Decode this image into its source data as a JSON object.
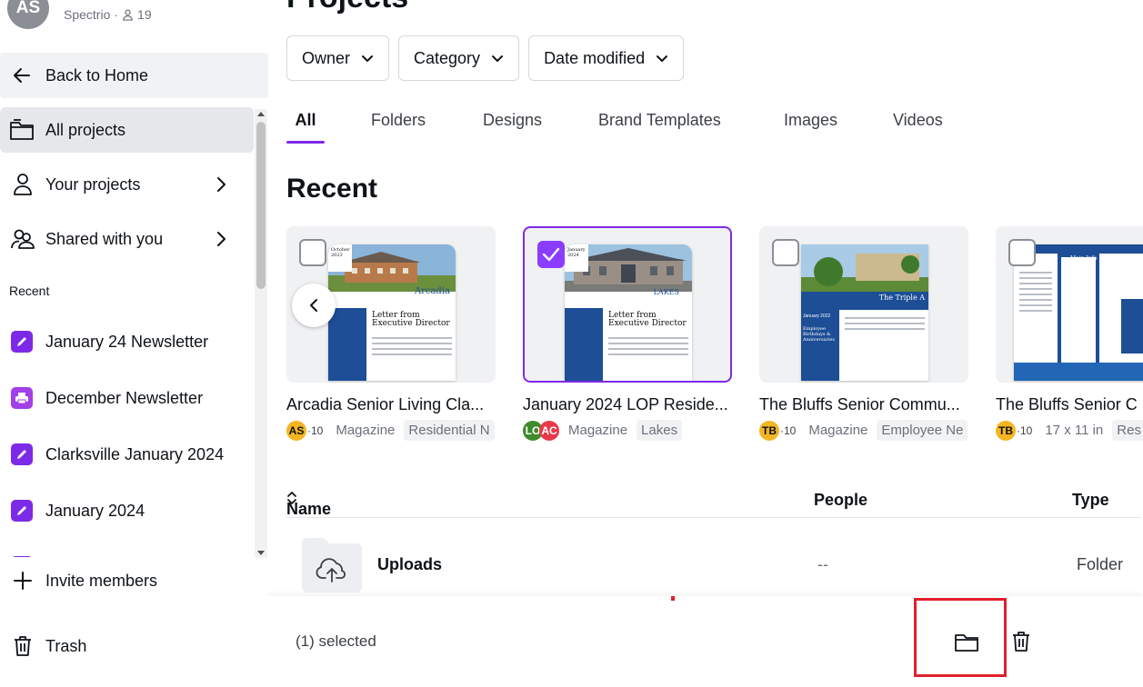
{
  "team": {
    "initials": "AS",
    "name": "Spectrio",
    "members": "19"
  },
  "sidebar": {
    "back_home": "Back to Home",
    "nav": [
      {
        "label": "All projects"
      },
      {
        "label": "Your projects"
      },
      {
        "label": "Shared with you"
      }
    ],
    "recent_heading": "Recent",
    "recent": [
      {
        "label": "January 24 Newsletter"
      },
      {
        "label": "December Newsletter"
      },
      {
        "label": "Clarksville January 2024"
      },
      {
        "label": "January 2024"
      }
    ],
    "invite": "Invite members",
    "trash": "Trash"
  },
  "main": {
    "title": "Projects",
    "filters": [
      {
        "label": "Owner"
      },
      {
        "label": "Category"
      },
      {
        "label": "Date modified"
      }
    ],
    "tabs": [
      {
        "label": "All",
        "active": true
      },
      {
        "label": "Folders"
      },
      {
        "label": "Designs"
      },
      {
        "label": "Brand Templates"
      },
      {
        "label": "Images"
      },
      {
        "label": "Videos"
      }
    ],
    "recent_title": "Recent",
    "cards": [
      {
        "title": "Arcadia Senior Living Cla...",
        "owner": "AS",
        "extra": "·10",
        "type": "Magazine",
        "tag": "Residential N",
        "date": "October 2023",
        "heading": "Letter from Executive Director",
        "brand": "Arcadia",
        "selected": false
      },
      {
        "title": "January 2024 LOP Reside...",
        "owner": "LO",
        "owner2": "AC",
        "type": "Magazine",
        "tag": "Lakes",
        "date": "January 2024",
        "heading": "Letter from Executive Director",
        "brand": "LAKES",
        "selected": true
      },
      {
        "title": "The Bluffs Senior Commu...",
        "owner": "TB",
        "extra": "·10",
        "type": "Magazine",
        "tag": "Employee Ne",
        "date": "January 2022",
        "heading": "Employee Birthdays & Anniversaries",
        "brand": "The Triple A",
        "selected": false
      },
      {
        "title": "The Bluffs Senior C",
        "owner": "TB",
        "extra": "·10",
        "type": "17 x 11 in",
        "tag": "Res",
        "date": "",
        "heading": "Main Info",
        "brand": "",
        "selected": false
      }
    ],
    "table": {
      "columns": {
        "name": "Name",
        "people": "People",
        "type": "Type"
      },
      "rows": [
        {
          "name": "Uploads",
          "people": "--",
          "type": "Folder"
        }
      ]
    },
    "action_bar": {
      "selected_text": "(1) selected"
    }
  },
  "colors": {
    "accent": "#7d2ae8",
    "highlight": "#e0202b",
    "magazine_blue": "#1d4e96"
  },
  "icons": [
    "arrow-left-icon",
    "folder-icon",
    "person-icon",
    "people-icon",
    "chevron-right-icon",
    "chevron-down-icon",
    "edit-icon",
    "print-icon",
    "plus-icon",
    "trash-icon",
    "check-icon",
    "chevron-left-icon",
    "upload-cloud-icon",
    "sort-icon"
  ]
}
